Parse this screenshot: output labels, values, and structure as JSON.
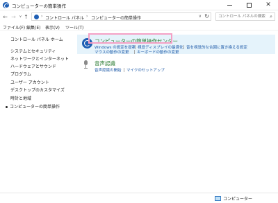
{
  "window": {
    "title": "コンピューターの簡単操作",
    "controls": {
      "minimize": "—",
      "maximize": "□",
      "close": "✕"
    }
  },
  "nav": {
    "back_icon": "←",
    "forward_icon": "→",
    "recent_icon": "∨",
    "up_icon": "↑",
    "breadcrumb": [
      "コントロール パネル",
      "コンピューターの簡単操作"
    ],
    "breadcrumb_separator": "›",
    "dropdown_icon": "∨",
    "refresh_icon": "↻",
    "search_placeholder": "コントロール パネルの検索",
    "search_icon": "⌕"
  },
  "menu": {
    "items": [
      "ファイル(F)",
      "編集(E)",
      "表示(V)",
      "ツール(T)"
    ]
  },
  "sidebar": {
    "home": "コントロール パネル ホーム",
    "items": [
      "システムとセキュリティ",
      "ネットワークとインターネット",
      "ハードウェアとサウンド",
      "プログラム",
      "ユーザー アカウント",
      "デスクトップのカスタマイズ",
      "時計と地域"
    ],
    "current": "コンピューターの簡単操作"
  },
  "main": {
    "ease_center": {
      "title": "コンピューターの簡単操作センター",
      "links": [
        "Windows の設定を提案",
        "視覚ディスプレイの最適化",
        "音を視覚的な合図に置き換える設定",
        "マウスの動作の変更",
        "キーボードの動作の変更"
      ]
    },
    "speech": {
      "title": "音声認識",
      "links": [
        "音声認識の開始",
        "マイクのセットアップ"
      ]
    }
  },
  "status": {
    "label": "コンピューター"
  },
  "colors": {
    "accent_link": "#1e5aa8",
    "section_title": "#2d7d34",
    "highlight": "#f5a0c5",
    "selected_bg": "#e5f3fb"
  }
}
